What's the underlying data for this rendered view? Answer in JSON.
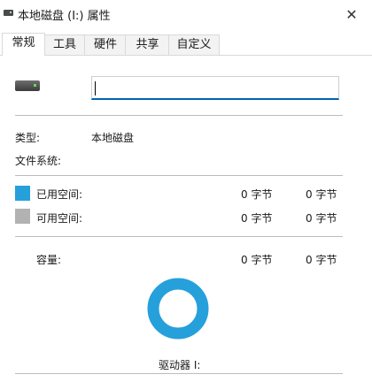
{
  "window": {
    "title": "本地磁盘 (I:) 属性",
    "close_glyph": "✕"
  },
  "tabs": [
    {
      "label": "常规",
      "active": true
    },
    {
      "label": "工具",
      "active": false
    },
    {
      "label": "硬件",
      "active": false
    },
    {
      "label": "共享",
      "active": false
    },
    {
      "label": "自定义",
      "active": false
    }
  ],
  "general": {
    "name_value": "",
    "type_label": "类型:",
    "type_value": "本地磁盘",
    "fs_label": "文件系统:",
    "fs_value": "",
    "used_label": "已用空间:",
    "used_bytes": "0 字节",
    "used_size": "0 字节",
    "free_label": "可用空间:",
    "free_bytes": "0 字节",
    "free_size": "0 字节",
    "capacity_label": "容量:",
    "capacity_bytes": "0 字节",
    "capacity_size": "0 字节",
    "drive_label": "驱动器 I:"
  },
  "colors": {
    "used": "#26a0da",
    "free": "#b2b2b2",
    "accent": "#0063b1"
  },
  "icons": {
    "drive": "hard-drive-icon",
    "close": "close-icon"
  }
}
